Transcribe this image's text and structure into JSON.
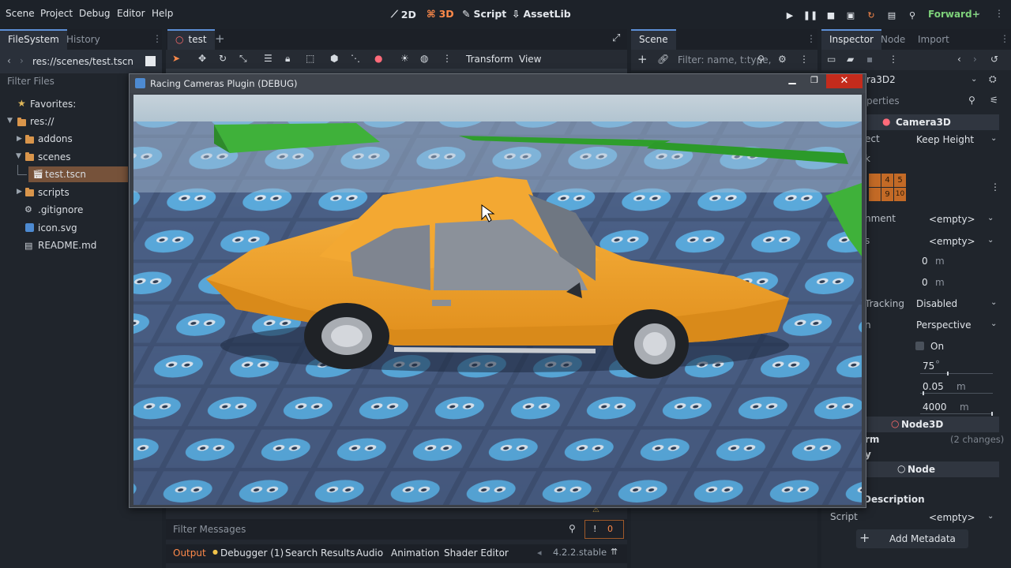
{
  "menu": {
    "items": [
      "Scene",
      "Project",
      "Debug",
      "Editor",
      "Help"
    ]
  },
  "modes": {
    "two_d": "2D",
    "three_d": "3D",
    "script": "Script",
    "assetlib": "AssetLib"
  },
  "renderer": "Forward+",
  "filesystem": {
    "tab_filesystem": "FileSystem",
    "tab_history": "History",
    "path": "res://scenes/test.tscn",
    "filter": "Filter Files",
    "favorites": "Favorites:",
    "root": "res://",
    "addons": "addons",
    "scenes": "scenes",
    "test_scene": "test.tscn",
    "scripts": "scripts",
    "gitignore": ".gitignore",
    "icon_svg": "icon.svg",
    "readme": "README.md"
  },
  "scene_tabs": {
    "tab_name": "test",
    "transform": "Transform",
    "view": "View"
  },
  "scene_dock": {
    "tab": "Scene",
    "filter_placeholder": "Filter: name, t:type,"
  },
  "inspector": {
    "tab_inspector": "Inspector",
    "tab_node": "Node",
    "tab_import": "Import",
    "node_name": "ra3D2",
    "filter_placeholder": "perties",
    "section_camera": "Camera3D",
    "keep_aspect_label": "ect",
    "keep_aspect_value": "Keep Height",
    "cull_mask_label": "k",
    "layers_row1": [
      "4",
      "5"
    ],
    "layers_row2": [
      "9",
      "10"
    ],
    "environment_label": "nment",
    "environment_value": "<empty>",
    "attributes_label": "s",
    "attributes_value": "<empty>",
    "h_offset": "0",
    "h_unit": "m",
    "v_offset": "0",
    "v_unit": "m",
    "doppler_label": "Tracking",
    "doppler_value": "Disabled",
    "projection_label": "n",
    "projection_value": "Perspective",
    "current_label": "On",
    "fov": "75",
    "fov_unit": "°",
    "near": "0.05",
    "near_unit": "m",
    "far": "4000",
    "far_unit": "m",
    "section_node3d": "Node3D",
    "transform_label": "rm",
    "transform_changes": "(2 changes)",
    "visibility_label": "y",
    "section_node": "Node",
    "description_label": "Description",
    "script_label": "Script",
    "script_value": "<empty>",
    "add_metadata": "Add Metadata"
  },
  "bottom": {
    "filter_messages": "Filter Messages",
    "error_count": "0",
    "tabs": {
      "output": "Output",
      "debugger": "Debugger (1)",
      "search": "Search Results",
      "audio": "Audio",
      "animation": "Animation",
      "shader": "Shader Editor"
    },
    "version": "4.2.2.stable"
  },
  "game_window": {
    "title": "Racing Cameras Plugin (DEBUG)"
  },
  "colors": {
    "accent_orange": "#ff8a4a",
    "car_body": "#f4a42c",
    "sky": "#b8ccd9",
    "floor_tile": "#3c4d6e",
    "godot_logo": "#4fa9dd",
    "ramp_green": "#3fb13a"
  }
}
